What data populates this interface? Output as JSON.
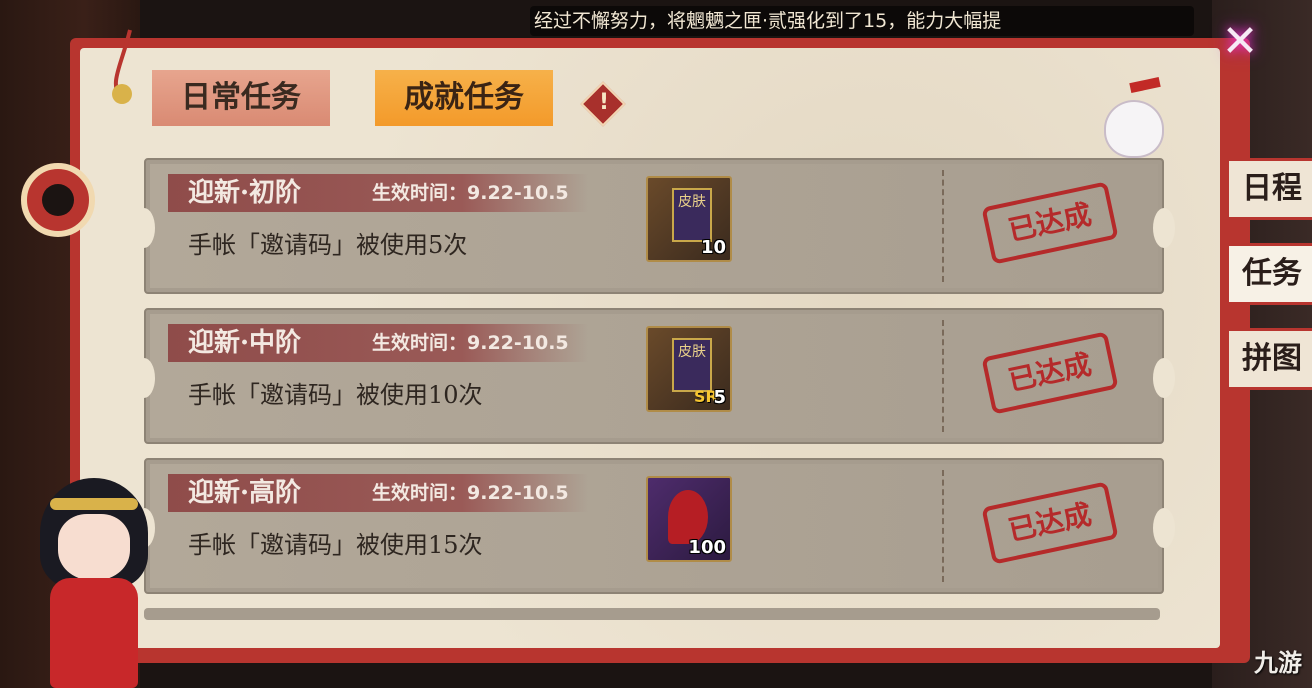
{
  "marquee_text": "经过不懈努力，将魍魉之匣·贰强化到了15，能力大幅提",
  "close_label": "✕",
  "tabs": [
    {
      "label": "日常任务",
      "active": false
    },
    {
      "label": "成就任务",
      "active": true
    }
  ],
  "warn_label": "!",
  "side_tabs": [
    {
      "label": "日程",
      "active": false
    },
    {
      "label": "任务",
      "active": true
    },
    {
      "label": "拼图",
      "active": false
    }
  ],
  "tasks": [
    {
      "title": "迎新·初阶",
      "time": "生效时间：9.22-10.5",
      "desc": "手帐「邀请码」被使用5次",
      "reward_icon": "skin-banner-icon",
      "reward_flag_text": "皮肤",
      "reward_count": "10",
      "reward_badge": "",
      "status": "已达成"
    },
    {
      "title": "迎新·中阶",
      "time": "生效时间：9.22-10.5",
      "desc": "手帐「邀请码」被使用10次",
      "reward_icon": "skin-banner-sr-icon",
      "reward_flag_text": "皮肤",
      "reward_count": "5",
      "reward_badge": "SR",
      "status": "已达成"
    },
    {
      "title": "迎新·高阶",
      "time": "生效时间：9.22-10.5",
      "desc": "手帐「邀请码」被使用15次",
      "reward_icon": "magatama-icon",
      "reward_flag_text": "",
      "reward_count": "100",
      "reward_badge": "",
      "status": "已达成"
    }
  ],
  "watermark": "九游",
  "colors": {
    "frame": "#b8352f",
    "paper": "#ede4d2",
    "tab_active": "#f39a2a",
    "stamp": "#b52a2a"
  }
}
